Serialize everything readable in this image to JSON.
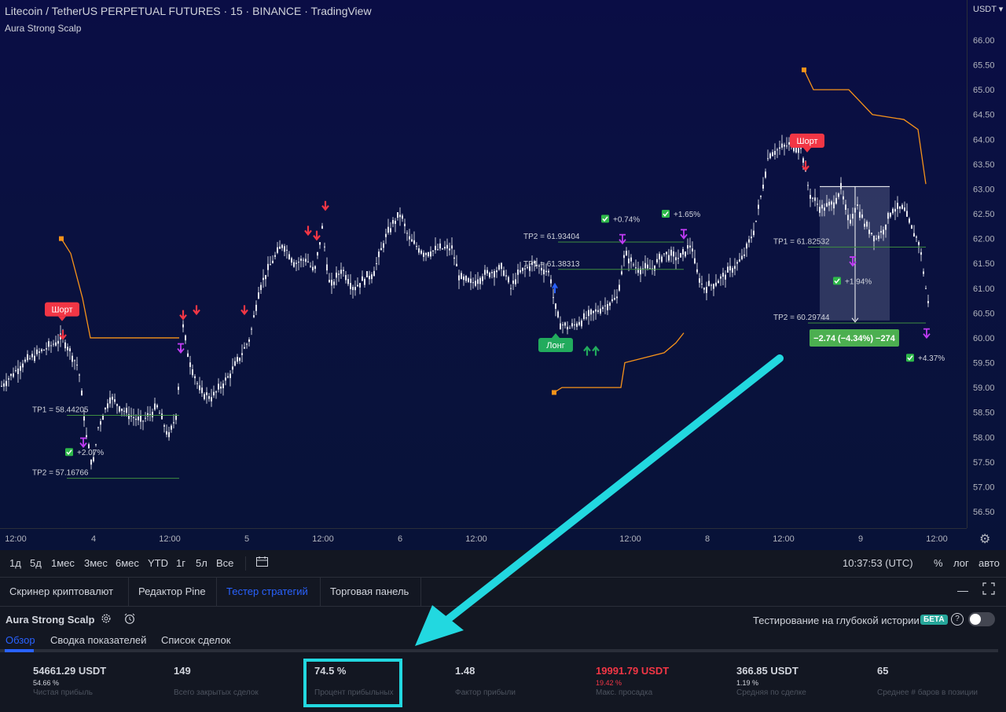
{
  "header": {
    "title": "Litecoin / TetherUS PERPETUAL FUTURES · 15 · BINANCE · TradingView",
    "indicator": "Aura Strong Scalp",
    "currency": "USDT ▾"
  },
  "chart_data": {
    "type": "candlestick",
    "y_ticks": [
      "66.00",
      "65.50",
      "65.00",
      "64.50",
      "64.00",
      "63.50",
      "63.00",
      "62.50",
      "62.00",
      "61.50",
      "61.00",
      "60.50",
      "60.00",
      "59.50",
      "59.00",
      "58.50",
      "58.00",
      "57.50",
      "57.00",
      "56.50"
    ],
    "ylim": [
      56.5,
      66.0
    ],
    "x_ticks": [
      "12:00",
      "4",
      "12:00",
      "5",
      "12:00",
      "6",
      "12:00",
      "7",
      "12:00",
      "8",
      "12:00",
      "9",
      "12:00"
    ],
    "price_path": [
      [
        0,
        59.0
      ],
      [
        30,
        59.5
      ],
      [
        60,
        59.8
      ],
      [
        80,
        60.0
      ],
      [
        100,
        59.4
      ],
      [
        110,
        58.0
      ],
      [
        118,
        57.4
      ],
      [
        125,
        58.2
      ],
      [
        140,
        58.8
      ],
      [
        160,
        58.5
      ],
      [
        180,
        58.3
      ],
      [
        200,
        58.6
      ],
      [
        215,
        58.0
      ],
      [
        225,
        58.5
      ],
      [
        232,
        60.3
      ],
      [
        240,
        59.6
      ],
      [
        255,
        58.9
      ],
      [
        270,
        58.8
      ],
      [
        290,
        59.2
      ],
      [
        305,
        59.6
      ],
      [
        318,
        60.0
      ],
      [
        330,
        61.0
      ],
      [
        345,
        61.5
      ],
      [
        360,
        61.9
      ],
      [
        375,
        61.5
      ],
      [
        390,
        61.6
      ],
      [
        400,
        61.3
      ],
      [
        410,
        62.2
      ],
      [
        420,
        61.0
      ],
      [
        435,
        61.4
      ],
      [
        450,
        61.0
      ],
      [
        465,
        61.2
      ],
      [
        475,
        61.3
      ],
      [
        490,
        62.0
      ],
      [
        500,
        62.3
      ],
      [
        510,
        62.5
      ],
      [
        520,
        62.0
      ],
      [
        540,
        61.7
      ],
      [
        560,
        61.8
      ],
      [
        575,
        61.8
      ],
      [
        585,
        61.2
      ],
      [
        600,
        61.1
      ],
      [
        620,
        61.3
      ],
      [
        640,
        61.4
      ],
      [
        650,
        61.0
      ],
      [
        660,
        61.3
      ],
      [
        680,
        61.5
      ],
      [
        700,
        61.3
      ],
      [
        705,
        60.7
      ],
      [
        712,
        60.3
      ],
      [
        725,
        60.2
      ],
      [
        745,
        60.4
      ],
      [
        765,
        60.6
      ],
      [
        785,
        60.8
      ],
      [
        795,
        61.7
      ],
      [
        810,
        61.4
      ],
      [
        830,
        61.4
      ],
      [
        845,
        61.7
      ],
      [
        865,
        61.6
      ],
      [
        880,
        61.9
      ],
      [
        885,
        61.4
      ],
      [
        895,
        61.0
      ],
      [
        910,
        61.1
      ],
      [
        925,
        61.3
      ],
      [
        945,
        61.6
      ],
      [
        960,
        62.2
      ],
      [
        970,
        63.0
      ],
      [
        978,
        63.7
      ],
      [
        990,
        63.8
      ],
      [
        1005,
        63.9
      ],
      [
        1020,
        63.8
      ],
      [
        1030,
        62.9
      ],
      [
        1045,
        62.6
      ],
      [
        1060,
        62.7
      ],
      [
        1070,
        63.0
      ],
      [
        1080,
        62.3
      ],
      [
        1090,
        62.7
      ],
      [
        1100,
        62.3
      ],
      [
        1115,
        62.0
      ],
      [
        1125,
        62.2
      ],
      [
        1135,
        62.6
      ],
      [
        1150,
        62.6
      ],
      [
        1160,
        62.2
      ],
      [
        1170,
        61.9
      ],
      [
        1178,
        61.0
      ],
      [
        1182,
        60.6
      ]
    ],
    "stop_lines": [
      {
        "points": [
          [
            78,
            62.0
          ],
          [
            90,
            61.7
          ],
          [
            105,
            60.8
          ],
          [
            115,
            60.0
          ],
          [
            228,
            60.0
          ]
        ]
      },
      {
        "points": [
          [
            705,
            58.9
          ],
          [
            715,
            59.0
          ],
          [
            790,
            59.0
          ],
          [
            795,
            59.5
          ],
          [
            845,
            59.7
          ],
          [
            860,
            59.9
          ],
          [
            870,
            60.1
          ]
        ]
      },
      {
        "points": [
          [
            1023,
            65.4
          ],
          [
            1035,
            65.0
          ],
          [
            1080,
            65.0
          ],
          [
            1110,
            64.5
          ],
          [
            1150,
            64.4
          ],
          [
            1168,
            64.2
          ],
          [
            1178,
            63.1
          ]
        ]
      }
    ],
    "levels": [
      {
        "label": "TP1 = 58.44205",
        "x1": 85,
        "x2": 228,
        "y": 58.44
      },
      {
        "label": "TP2 = 57.16766",
        "x1": 85,
        "x2": 228,
        "y": 57.17
      },
      {
        "label": "TP2 = 61.93404",
        "x1": 710,
        "x2": 870,
        "y": 61.93
      },
      {
        "label": "TP1 = 61.38313",
        "x1": 710,
        "x2": 870,
        "y": 61.38
      },
      {
        "label": "TP1 = 61.82532",
        "x1": 1028,
        "x2": 1178,
        "y": 61.83
      },
      {
        "label": "TP2 = 60.29744",
        "x1": 1028,
        "x2": 1178,
        "y": 60.3
      }
    ],
    "signals": [
      {
        "label": "Шорт",
        "type": "short",
        "x": 79,
        "y": 60.4
      },
      {
        "label": "Лонг",
        "type": "long",
        "x": 707,
        "y": 60.0
      },
      {
        "label": "Шорт",
        "type": "short",
        "x": 1027,
        "y": 63.8
      }
    ],
    "profit_labels": [
      {
        "text": "+2.07%",
        "x": 88,
        "y": 57.7
      },
      {
        "text": "+0.74%",
        "x": 770,
        "y": 62.4
      },
      {
        "text": "+1.65%",
        "x": 847,
        "y": 62.5
      },
      {
        "text": "+1.94%",
        "x": 1065,
        "y": 61.15
      },
      {
        "text": "+4.37%",
        "x": 1158,
        "y": 59.6
      }
    ],
    "measure": {
      "text": "−2.74 (−4.34%) −274",
      "x": 1030,
      "y": 60.0
    }
  },
  "toolbar": {
    "timeframes": [
      "1д",
      "5д",
      "1мес",
      "3мес",
      "6мес",
      "YTD",
      "1г",
      "5л",
      "Все"
    ],
    "clock": "10:37:53 (UTC)",
    "pct": "%",
    "log": "лог",
    "auto": "авто"
  },
  "panel_tabs": {
    "screener": "Скринер криптовалют",
    "pine": "Редактор Pine",
    "tester": "Тестер стратегий",
    "trading": "Торговая панель"
  },
  "strategy": {
    "name": "Aura Strong Scalp",
    "deep_history": "Тестирование на глубокой истории",
    "beta": "БЕТА",
    "help": "?"
  },
  "subtabs": [
    "Обзор",
    "Сводка показателей",
    "Список сделок"
  ],
  "metrics": [
    {
      "value": "54661.29 USDT",
      "pct": "54.66 %",
      "label": "Чистая прибыль",
      "red": false
    },
    {
      "value": "149",
      "pct": "",
      "label": "Всего закрытых сделок",
      "red": false
    },
    {
      "value": "74.5 %",
      "pct": "",
      "label": "Процент прибыльных",
      "red": false
    },
    {
      "value": "1.48",
      "pct": "",
      "label": "Фактор прибыли",
      "red": false
    },
    {
      "value": "19991.79 USDT",
      "pct": "19.42 %",
      "label": "Макс. просадка",
      "red": true
    },
    {
      "value": "366.85 USDT",
      "pct": "1.19 %",
      "label": "Средняя по сделке",
      "red": false
    },
    {
      "value": "65",
      "pct": "",
      "label": "Среднее # баров в позиции",
      "red": false
    }
  ]
}
